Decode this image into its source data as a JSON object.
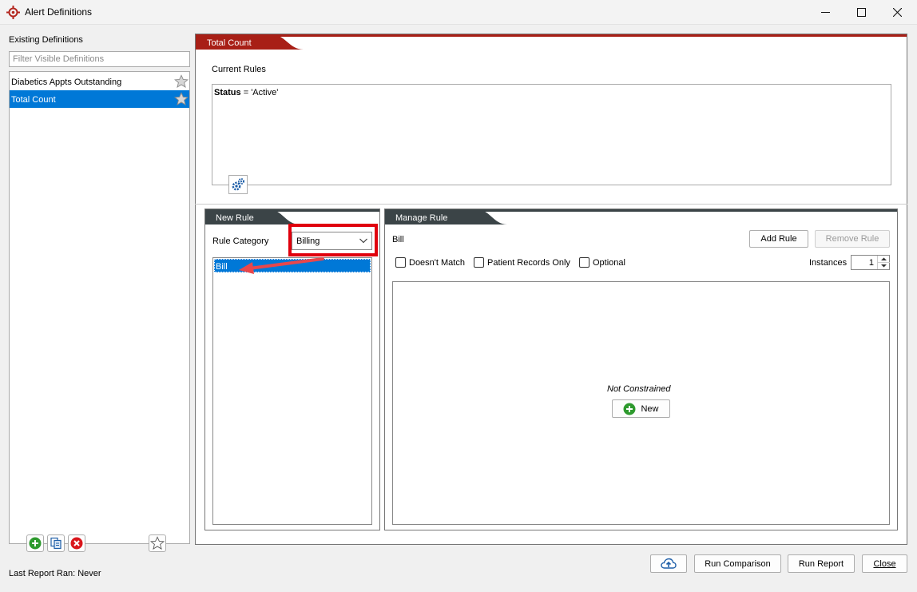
{
  "window": {
    "title": "Alert Definitions",
    "controls": [
      "minimize",
      "maximize",
      "close"
    ]
  },
  "left_panel": {
    "heading": "Existing Definitions",
    "filter_placeholder": "Filter Visible Definitions",
    "definitions": [
      {
        "label": "Diabetics Appts Outstanding",
        "selected": false
      },
      {
        "label": "Total Count",
        "selected": true
      }
    ],
    "toolbar_icons": [
      "add-icon",
      "copy-icon",
      "delete-icon",
      "star-icon"
    ],
    "last_report": "Last Report Ran: Never"
  },
  "main": {
    "tab_title": "Total Count",
    "current_rules_label": "Current Rules",
    "current_rule": {
      "field": "Status",
      "operator": "=",
      "value": "'Active'"
    },
    "new_rule": {
      "title": "New Rule",
      "category_label": "Rule Category",
      "category_value": "Billing",
      "rules": [
        "Bill"
      ]
    },
    "manage_rule": {
      "title": "Manage Rule",
      "selected_rule": "Bill",
      "add_label": "Add Rule",
      "remove_label": "Remove Rule",
      "options": [
        {
          "label": "Doesn't Match",
          "checked": false
        },
        {
          "label": "Patient Records Only",
          "checked": false
        },
        {
          "label": "Optional",
          "checked": false
        }
      ],
      "instances_label": "Instances",
      "instances_value": "1",
      "empty_text": "Not Constrained",
      "new_label": "New"
    }
  },
  "footer": {
    "upload_icon": "cloud-upload-icon",
    "run_comparison": "Run Comparison",
    "run_report": "Run Report",
    "close": "Close"
  },
  "colors": {
    "accent_red": "#a81f16",
    "header_dark": "#3b4447",
    "selection_blue": "#0078d7",
    "highlight_red": "#e0000d",
    "arrow_red": "#e8474c",
    "green": "#2e9a2e"
  }
}
